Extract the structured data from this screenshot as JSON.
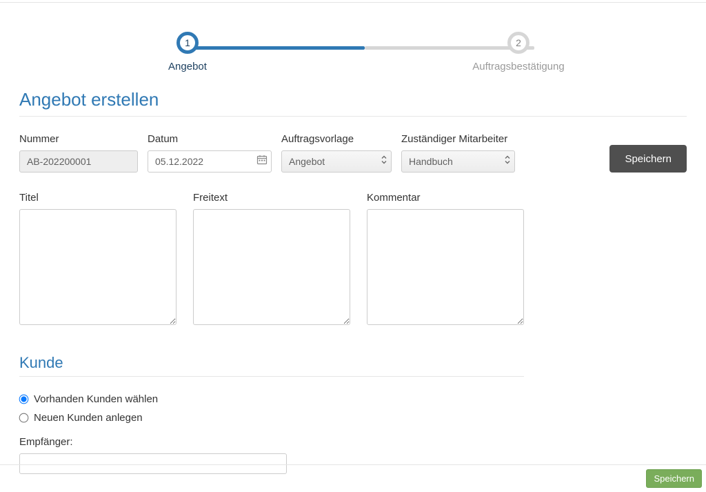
{
  "stepper": {
    "step1": {
      "number": "1",
      "label": "Angebot"
    },
    "step2": {
      "number": "2",
      "label": "Auftragsbestätigung"
    }
  },
  "page": {
    "title": "Angebot erstellen"
  },
  "form": {
    "nummer_label": "Nummer",
    "nummer_value": "AB-202200001",
    "datum_label": "Datum",
    "datum_value": "05.12.2022",
    "vorlage_label": "Auftragsvorlage",
    "vorlage_value": "Angebot",
    "mitarbeiter_label": "Zuständiger Mitarbeiter",
    "mitarbeiter_value": "Handbuch",
    "save_label": "Speichern",
    "titel_label": "Titel",
    "freitext_label": "Freitext",
    "kommentar_label": "Kommentar"
  },
  "kunde": {
    "title": "Kunde",
    "radio_existing": "Vorhanden Kunden wählen",
    "radio_new": "Neuen Kunden anlegen",
    "empf_label": "Empfänger:"
  },
  "footer": {
    "save_label": "Speichern"
  }
}
